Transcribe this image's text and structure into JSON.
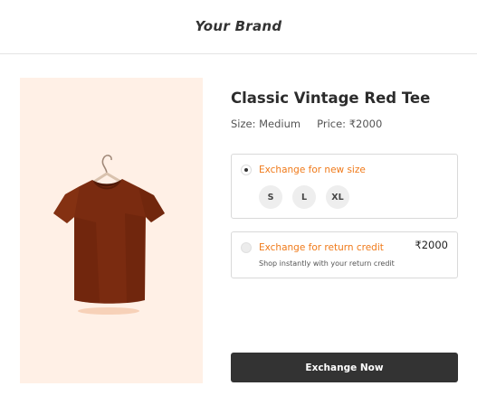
{
  "header": {
    "brand": "Your Brand"
  },
  "product": {
    "title": "Classic Vintage Red Tee",
    "size_text": "Size: Medium",
    "price_text": "Price: ₹2000",
    "image_icon": "tshirt-on-hanger"
  },
  "options": [
    {
      "label": "Exchange for new size",
      "selected": true,
      "sizes": [
        "S",
        "L",
        "XL"
      ]
    },
    {
      "label": "Exchange for return credit",
      "selected": false,
      "amount": "₹2000",
      "subtext": "Shop instantly with your return credit"
    }
  ],
  "cta": {
    "label": "Exchange Now"
  },
  "colors": {
    "accent": "#f07a1a",
    "image_bg": "#fff0e6",
    "shirt": "#7a2b10",
    "button": "#333333"
  }
}
